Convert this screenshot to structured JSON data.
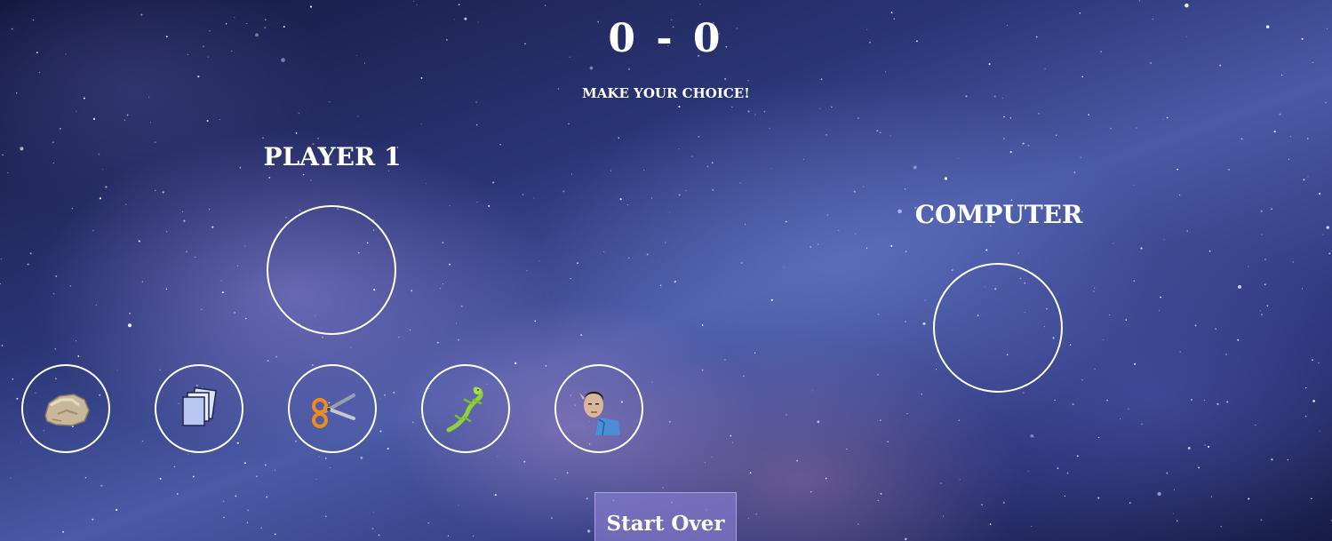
{
  "score": {
    "text": "0 - 0"
  },
  "prompt": "MAKE YOUR CHOICE!",
  "player": {
    "label": "PLAYER 1"
  },
  "computer": {
    "label": "COMPUTER"
  },
  "choices": [
    {
      "name": "rock",
      "icon": "rock-icon"
    },
    {
      "name": "paper",
      "icon": "paper-icon"
    },
    {
      "name": "scissors",
      "icon": "scissors-icon"
    },
    {
      "name": "lizard",
      "icon": "lizard-icon"
    },
    {
      "name": "spock",
      "icon": "spock-icon"
    }
  ],
  "start_over_label": "Start Over",
  "colors": {
    "text": "#ffffff",
    "ring": "#ffffff",
    "button_bg": "#8278c8"
  }
}
